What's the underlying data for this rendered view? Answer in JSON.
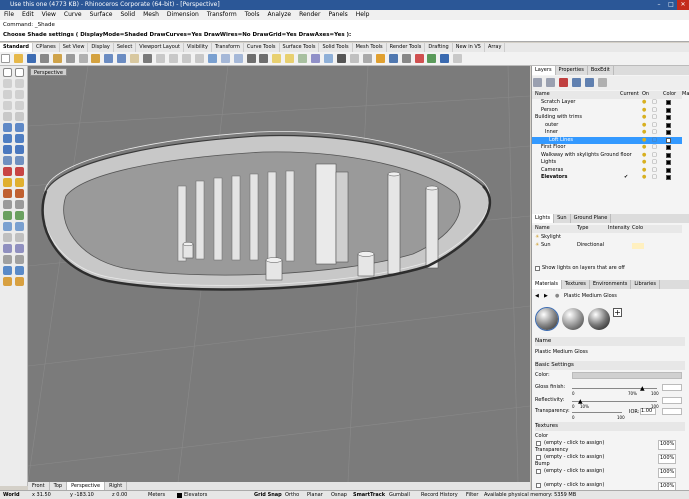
{
  "window": {
    "title": "Use this one (4773 KB) - Rhinoceros Corporate (64-bit) - [Perspective]",
    "controls": [
      "–",
      "□",
      "✕"
    ]
  },
  "menu": [
    "File",
    "Edit",
    "View",
    "Curve",
    "Surface",
    "Solid",
    "Mesh",
    "Dimension",
    "Transform",
    "Tools",
    "Analyze",
    "Render",
    "Panels",
    "Help"
  ],
  "command": {
    "history": "Command: _Shade",
    "prompt": "Choose Shade settings ( DisplayMode=Shaded  DrawCurves=Yes  DrawWires=No  DrawGrid=Yes  DrawAxes=Yes ):"
  },
  "toolbar_tabs": [
    "Standard",
    "CPlanes",
    "Set View",
    "Display",
    "Select",
    "Viewport Layout",
    "Visibility",
    "Transform",
    "Curve Tools",
    "Surface Tools",
    "Solid Tools",
    "Mesh Tools",
    "Render Tools",
    "Drafting",
    "New in V5",
    "Array"
  ],
  "viewport": {
    "name": "Perspective",
    "tabs": [
      "Front",
      "Top",
      "Perspective",
      "Right"
    ]
  },
  "layers_panel": {
    "tabs": [
      "Layers",
      "Properties",
      "BoxEdit"
    ],
    "headers": [
      "Name",
      "Current",
      "On",
      "Color",
      "Ma"
    ],
    "rows": [
      {
        "name": "Scratch Layer",
        "color": "#000000"
      },
      {
        "name": "Person",
        "color": "#000000"
      },
      {
        "name": "Building with trims",
        "color": "#000000"
      },
      {
        "name": "outer",
        "color": "#000000"
      },
      {
        "name": "Inner",
        "color": "#000000"
      },
      {
        "name": "Loft Lines",
        "color": "#ffffff",
        "selected": true
      },
      {
        "name": "First Floor",
        "color": "#000000"
      },
      {
        "name": "Walkway with skylights Ground floor",
        "color": "#000000"
      },
      {
        "name": "Lights",
        "color": "#000000"
      },
      {
        "name": "Cameras",
        "color": "#000000"
      },
      {
        "name": "Elevators",
        "color": "#000000",
        "current": true
      }
    ],
    "current_mark": "✔"
  },
  "lights_panel": {
    "tabs": [
      "Lights",
      "Sun",
      "Ground Plane"
    ],
    "headers": [
      "Name",
      "Type",
      "Intensity",
      "Colo"
    ],
    "rows": [
      {
        "name": "Skylight",
        "type": ""
      },
      {
        "name": "Sun",
        "type": "Directional"
      }
    ],
    "show_all": "Show lights on layers that are off"
  },
  "materials_panel": {
    "tabs": [
      "Materials",
      "Textures",
      "Environments",
      "Libraries"
    ],
    "current": "Plastic Medium Gloss",
    "name_section": "Name",
    "name_value": "Plastic Medium Gloss",
    "basic_section": "Basic Settings",
    "color_label": "Color:",
    "gloss_label": "Gloss finish:",
    "gloss_ticks": [
      "0",
      "70%",
      "100"
    ],
    "reflectivity_label": "Reflectivity:",
    "reflectivity_ticks": [
      "0",
      "10%",
      "100"
    ],
    "transparency_label": "Transparency:",
    "transparency_ticks": [
      "0",
      "100"
    ],
    "ior_label": "IOR:",
    "ior_value": "1.00",
    "textures_section": "Textures",
    "slots": [
      {
        "label": "Color",
        "value": "(empty - click to assign)",
        "pct": "100%"
      },
      {
        "label": "Transparency",
        "value": "(empty - click to assign)",
        "pct": "100%"
      },
      {
        "label": "Bump",
        "value": "(empty - click to assign)",
        "pct": "100%"
      },
      {
        "label": "",
        "value": "(empty - click to assign)",
        "pct": "100%"
      }
    ]
  },
  "status": {
    "cplane": "World",
    "x": "x 31.50",
    "y": "y -183.10",
    "z": "z 0.00",
    "units": "Meters",
    "layer": "Elevators",
    "toggles": [
      "Grid Snap",
      "Ortho",
      "Planar",
      "Osnap",
      "SmartTrack",
      "Gumball",
      "Record History",
      "Filter"
    ],
    "memory": "Available physical memory: 5359 MB"
  }
}
